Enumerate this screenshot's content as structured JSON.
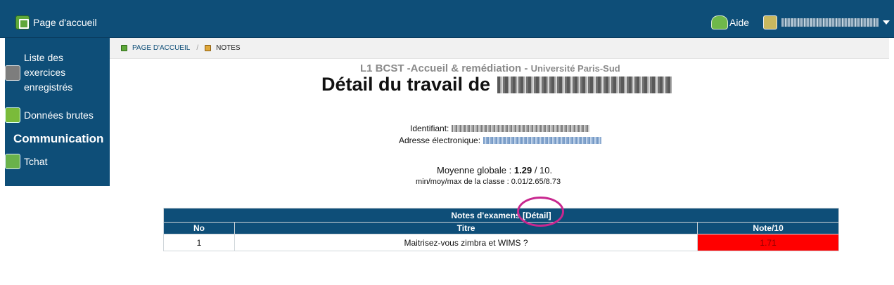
{
  "header": {
    "home_label": "Page d'accueil",
    "help_label": "Aide",
    "user_name_obscured": "",
    "colors": {
      "bar": "#0e4e78"
    }
  },
  "sidebar": {
    "items": [
      {
        "label_lines": [
          "Liste des",
          "exercices",
          "enregistrés"
        ],
        "icon": "exercise-list-icon"
      },
      {
        "label": "Données brutes",
        "icon": "raw-data-icon"
      },
      {
        "heading": "Communication"
      },
      {
        "label": "Tchat",
        "icon": "chat-icon"
      }
    ]
  },
  "breadcrumb": {
    "home": "PAGE D'ACCUEIL",
    "separator": "/",
    "current": "NOTES"
  },
  "course": {
    "name": "L1 BCST -Accueil & remédiation",
    "separator": "-",
    "university": "Université Paris-Sud"
  },
  "page_title": "Détail du travail de",
  "identity": {
    "id_label": "Identifiant:",
    "email_label": "Adresse électronique:"
  },
  "average": {
    "label": "Moyenne globale :",
    "value": "1.29",
    "scale": "/ 10.",
    "class_stats_label": "min/moy/max de la classe :",
    "class_stats_value": "0.01/2.65/8.73"
  },
  "exam_table": {
    "caption": "Notes d'examens",
    "detail_link": "[Détail]",
    "columns": [
      "No",
      "Titre",
      "Note/10"
    ],
    "rows": [
      {
        "no": "1",
        "title": "Maitrisez-vous zimbra et WIMS ?",
        "grade": "1.71"
      }
    ],
    "colors": {
      "header": "#0e4e78",
      "low_grade": "#ff0000"
    }
  },
  "annotation": {
    "color": "#c8278f"
  }
}
